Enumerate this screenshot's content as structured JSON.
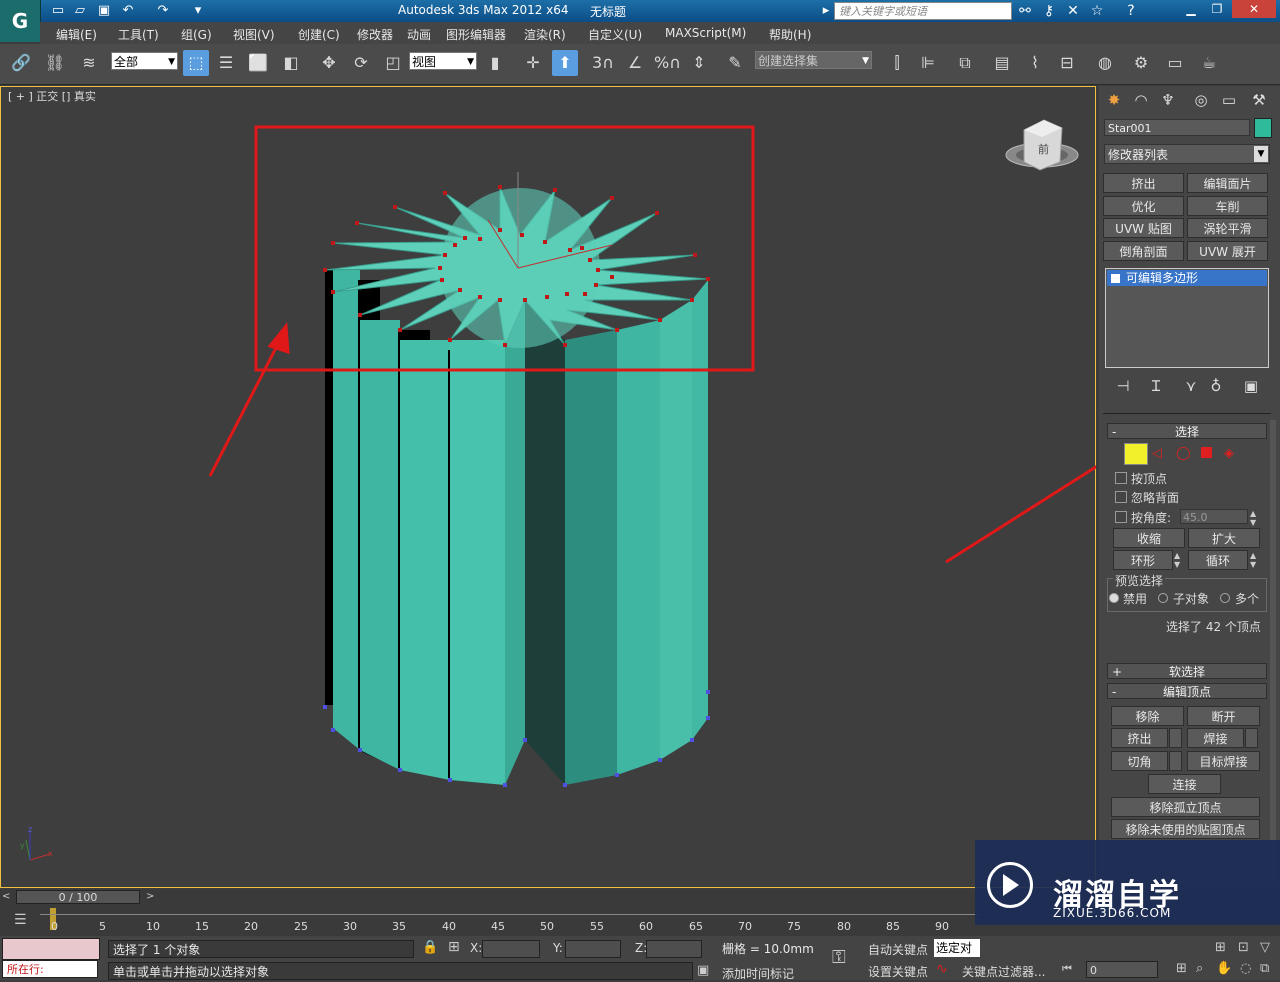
{
  "title_bar": {
    "app": "Autodesk 3ds Max  2012 x64",
    "document": "无标题",
    "search_placeholder": "键入关键字或短语"
  },
  "menu": [
    "编辑(E)",
    "工具(T)",
    "组(G)",
    "视图(V)",
    "创建(C)",
    "修改器",
    "动画",
    "图形编辑器",
    "渲染(R)",
    "自定义(U)",
    "MAXScript(M)",
    "帮助(H)"
  ],
  "toolbar": {
    "selection_filter": "全部",
    "reference_coord": "视图",
    "snap_label": "3",
    "angle_label": "%",
    "named_selection": "创建选择集"
  },
  "viewport": {
    "label": "[ + ] 正交 [] 真实",
    "viewcube_face": "前",
    "axis_labels": {
      "x": "x",
      "y": "y",
      "z": "z"
    }
  },
  "command_panel": {
    "object_name": "Star001",
    "object_color": "#2dbb9c",
    "modifier_list": "修改器列表",
    "modifier_buttons": [
      "挤出",
      "编辑面片",
      "优化",
      "车削",
      "UVW 贴图",
      "涡轮平滑",
      "倒角剖面",
      "UVW 展开"
    ],
    "stack_item": "可编辑多边形",
    "selection_rollout": {
      "title": "选择",
      "by_vertex": "按顶点",
      "ignore_backfacing": "忽略背面",
      "by_angle": "按角度:",
      "angle_value": "45.0",
      "shrink": "收缩",
      "grow": "扩大",
      "ring": "环形",
      "loop": "循环",
      "preview_title": "预览选择",
      "preview_options": [
        "禁用",
        "子对象",
        "多个"
      ],
      "status": "选择了 42 个顶点"
    },
    "soft_selection": "软选择",
    "edit_vertices": {
      "title": "编辑顶点",
      "remove": "移除",
      "break": "断开",
      "extrude": "挤出",
      "weld": "焊接",
      "chamfer": "切角",
      "target_weld": "目标焊接",
      "connect": "连接",
      "remove_isolated": "移除孤立顶点",
      "remove_unused_map": "移除未使用的贴图顶点"
    }
  },
  "timeline": {
    "frame_display": "0 / 100",
    "ticks": [
      "0",
      "5",
      "10",
      "15",
      "20",
      "25",
      "30",
      "35",
      "40",
      "45",
      "50",
      "55",
      "60",
      "65",
      "70",
      "75",
      "80",
      "85",
      "90"
    ]
  },
  "status": {
    "now_running": "所在行:",
    "selected_objects": "选择了 1 个对象",
    "prompt": "单击或单击并拖动以选择对象",
    "x_label": "X:",
    "y_label": "Y:",
    "z_label": "Z:",
    "grid": "栅格 = 10.0mm",
    "auto_key": "自动关键点",
    "selected_combo": "选定对",
    "set_key": "设置关键点",
    "key_filters": "关键点过滤器...",
    "add_time_tag": "添加时间标记",
    "frame_value": "0"
  },
  "watermark": {
    "brand": "溜溜自学",
    "url": "ZIXUE.3D66.COM"
  }
}
